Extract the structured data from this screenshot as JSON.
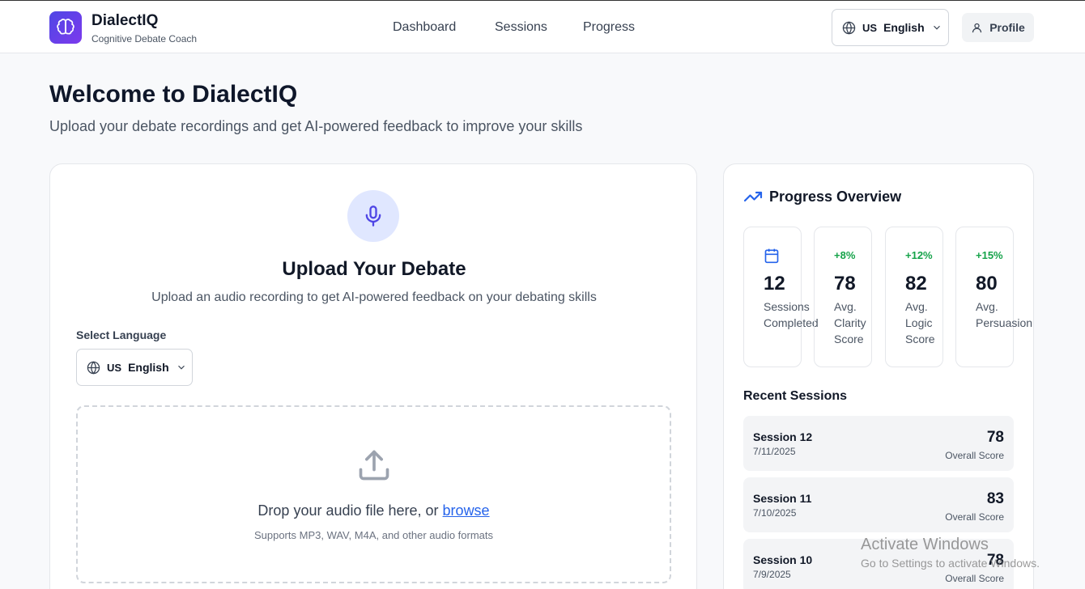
{
  "header": {
    "brand_name": "DialectIQ",
    "brand_subtitle": "Cognitive Debate Coach",
    "nav": [
      "Dashboard",
      "Sessions",
      "Progress"
    ],
    "language": {
      "flag": "US",
      "name": "English"
    },
    "profile_label": "Profile"
  },
  "page": {
    "title": "Welcome to DialectIQ",
    "subtitle": "Upload your debate recordings and get AI-powered feedback to improve your skills"
  },
  "upload": {
    "title": "Upload Your Debate",
    "subtitle": "Upload an audio recording to get AI-powered feedback on your debating skills",
    "language_label": "Select Language",
    "language": {
      "flag": "US",
      "name": "English"
    },
    "drop_text": "Drop your audio file here, or ",
    "browse_label": "browse",
    "hint": "Supports MP3, WAV, M4A, and other audio formats"
  },
  "progress": {
    "title": "Progress Overview",
    "stats": [
      {
        "delta": "",
        "value": "12",
        "label": "Sessions Completed"
      },
      {
        "delta": "+8%",
        "value": "78",
        "label": "Avg. Clarity Score"
      },
      {
        "delta": "+12%",
        "value": "82",
        "label": "Avg. Logic Score"
      },
      {
        "delta": "+15%",
        "value": "80",
        "label": "Avg. Persuasion"
      }
    ],
    "recent_title": "Recent Sessions",
    "sessions": [
      {
        "name": "Session 12",
        "date": "7/11/2025",
        "score": "78",
        "score_label": "Overall Score"
      },
      {
        "name": "Session 11",
        "date": "7/10/2025",
        "score": "83",
        "score_label": "Overall Score"
      },
      {
        "name": "Session 10",
        "date": "7/9/2025",
        "score": "78",
        "score_label": "Overall Score"
      }
    ]
  },
  "watermark": {
    "line1": "Activate Windows",
    "line2": "Go to Settings to activate Windows."
  },
  "colors": {
    "accent": "#4f46e5",
    "positive": "#16a34a",
    "link": "#2563eb"
  }
}
